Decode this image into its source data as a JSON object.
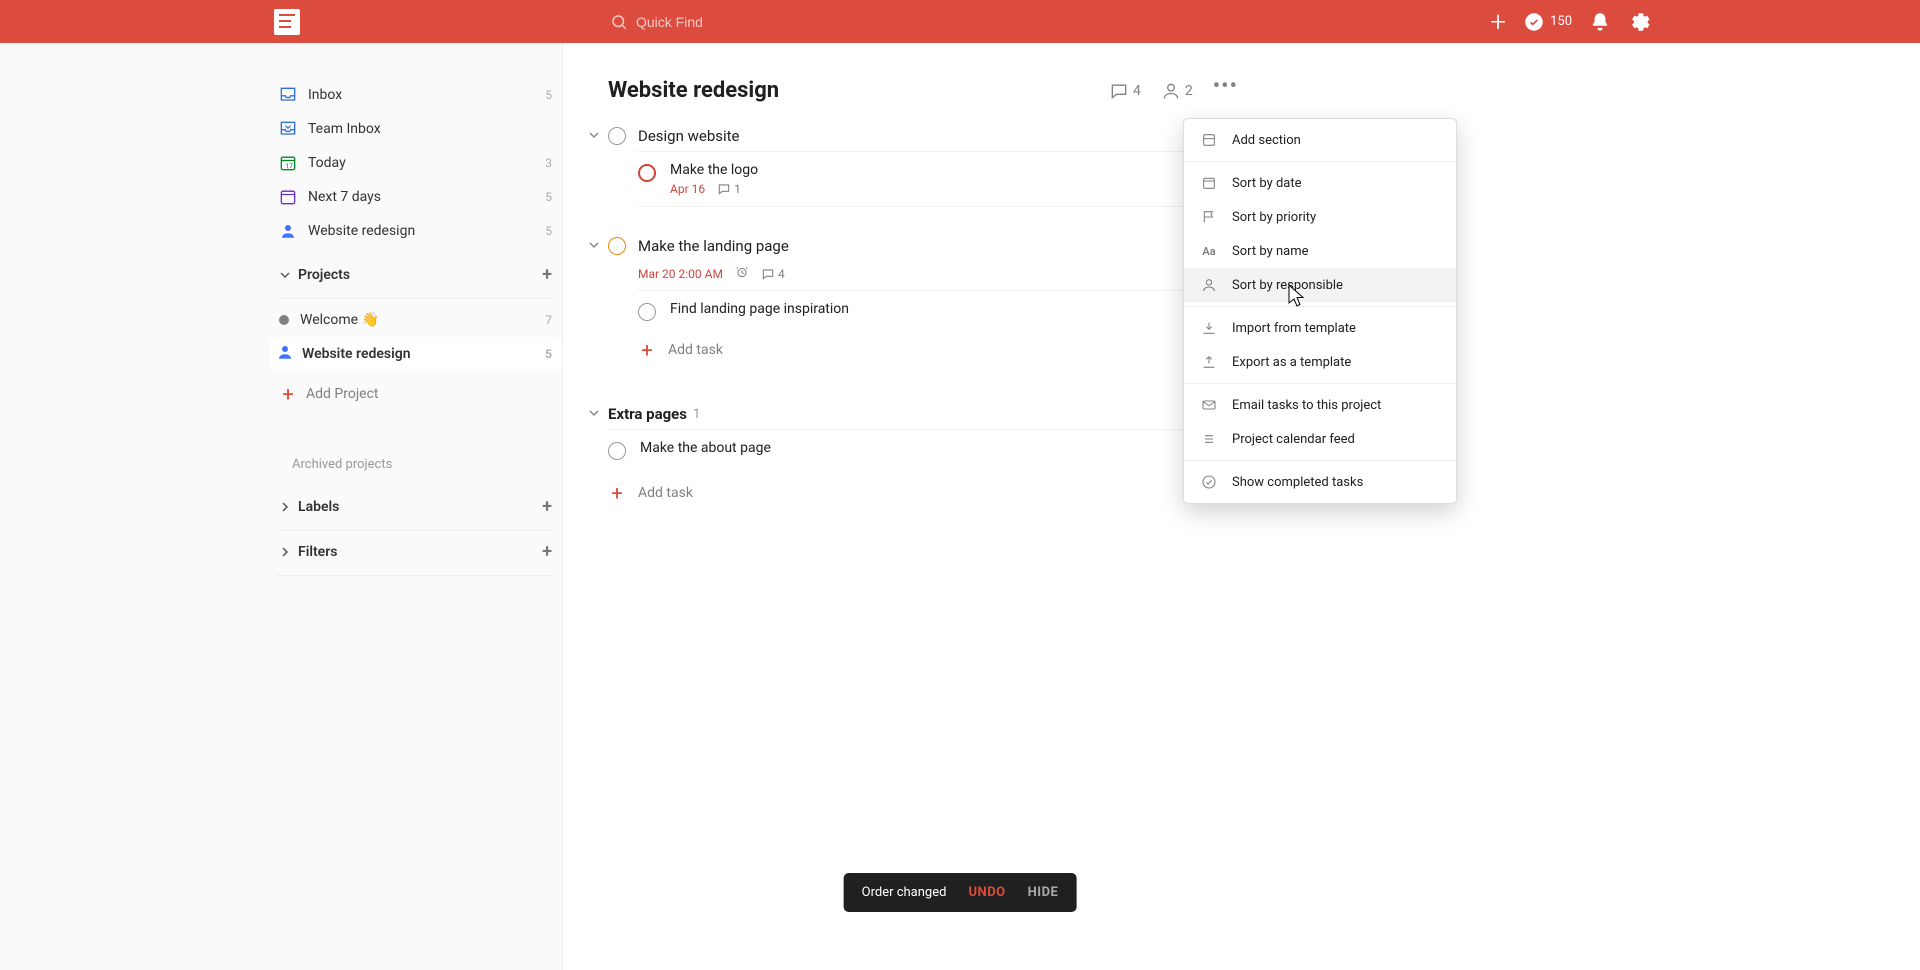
{
  "topbar": {
    "search_placeholder": "Quick Find",
    "karma": "150"
  },
  "sidebar": {
    "nav": [
      {
        "key": "inbox",
        "label": "Inbox",
        "count": "5"
      },
      {
        "key": "team",
        "label": "Team Inbox",
        "count": ""
      },
      {
        "key": "today",
        "label": "Today",
        "count": "3"
      },
      {
        "key": "next7",
        "label": "Next 7 days",
        "count": "5"
      },
      {
        "key": "shared",
        "label": "Website redesign",
        "count": "5"
      }
    ],
    "projects_header": "Projects",
    "projects": [
      {
        "key": "welcome",
        "label": "Welcome 👋",
        "count": "7",
        "color": "#808080"
      },
      {
        "key": "redesign",
        "label": "Website redesign",
        "count": "5",
        "color": "#4073ff",
        "active": true
      }
    ],
    "add_project": "Add Project",
    "archived": "Archived projects",
    "labels_header": "Labels",
    "filters_header": "Filters"
  },
  "project": {
    "title": "Website redesign",
    "comment_count": "4",
    "people_count": "2"
  },
  "sections": [
    {
      "key": "design",
      "title": "Design website",
      "title_meta": null,
      "tasks": [
        {
          "key": "logo",
          "title": "Make the logo",
          "priority": "p1",
          "date": "Apr 16",
          "date_over": true,
          "comments": "1",
          "alarm": false
        }
      ]
    },
    {
      "key": "landing",
      "title": "Make the landing page",
      "title_priority": "p2",
      "title_meta": {
        "date": "Mar 20 2:00 AM",
        "alarm": true,
        "comments": "4"
      },
      "tasks": [
        {
          "key": "inspo",
          "title": "Find landing page inspiration",
          "priority": "",
          "date": "",
          "date_over": false,
          "comments": "",
          "alarm": false
        }
      ]
    }
  ],
  "add_task_label": "Add task",
  "extra_section": {
    "title": "Extra pages",
    "count": "1",
    "tasks": [
      {
        "key": "about",
        "title": "Make the about page",
        "priority": ""
      }
    ]
  },
  "dropdown": {
    "add_section": "Add section",
    "sort_date": "Sort by date",
    "sort_priority": "Sort by priority",
    "sort_name": "Sort by name",
    "sort_responsible": "Sort by responsible",
    "import_template": "Import from template",
    "export_template": "Export as a template",
    "email_tasks": "Email tasks to this project",
    "calendar_feed": "Project calendar feed",
    "show_completed": "Show completed tasks"
  },
  "toast": {
    "message": "Order changed",
    "undo": "UNDO",
    "hide": "HIDE"
  }
}
